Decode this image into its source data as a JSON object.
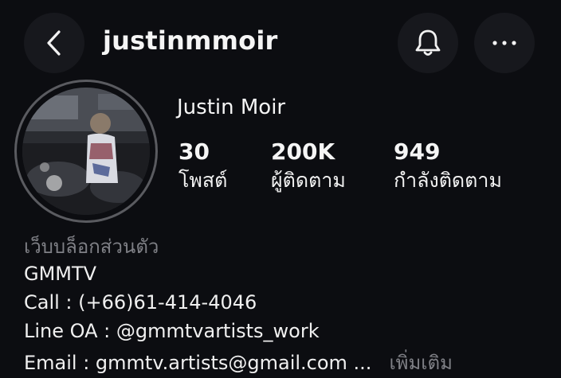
{
  "header": {
    "username": "justinmmoir"
  },
  "icons": {
    "back": "chevron-left-icon",
    "bell": "bell-icon",
    "more": "more-horizontal-icon"
  },
  "profile": {
    "display_name": "Justin Moir",
    "stats": [
      {
        "value": "30",
        "label": "โพสต์"
      },
      {
        "value": "200K",
        "label": "ผู้ติดตาม"
      },
      {
        "value": "949",
        "label": "กำลังติดตาม"
      }
    ],
    "category": "เว็บบล็อกส่วนตัว",
    "bio_lines": [
      "GMMTV",
      "Call : (+66)61-414-4046",
      "Line OA : @gmmtvartists_work",
      "Email : gmmtv.artists@gmail.com ..."
    ],
    "more_label": "เพิ่มเติม"
  },
  "colors": {
    "background": "#0c0d11",
    "button_bg": "#17181d",
    "muted_text": "#7f8086"
  }
}
